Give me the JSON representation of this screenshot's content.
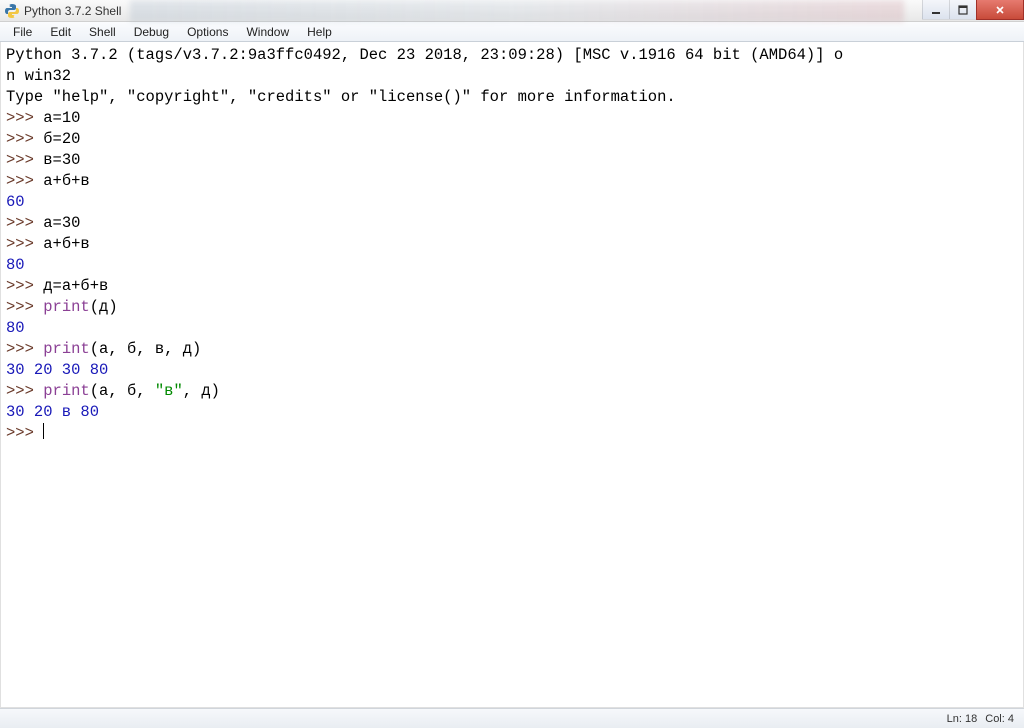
{
  "window": {
    "title": "Python 3.7.2 Shell"
  },
  "menus": [
    "File",
    "Edit",
    "Shell",
    "Debug",
    "Options",
    "Window",
    "Help"
  ],
  "shell": {
    "banner_l1": "Python 3.7.2 (tags/v3.7.2:9a3ffc0492, Dec 23 2018, 23:09:28) [MSC v.1916 64 bit (AMD64)] o",
    "banner_l2": "n win32",
    "banner_l3": "Type \"help\", \"copyright\", \"credits\" or \"license()\" for more information.",
    "prompt": ">>>",
    "lines": [
      {
        "in": "а=10"
      },
      {
        "in": "б=20"
      },
      {
        "in": "в=30"
      },
      {
        "in": "а+б+в"
      },
      {
        "out": "60"
      },
      {
        "in": "а=30"
      },
      {
        "in": "а+б+в"
      },
      {
        "out": "80"
      },
      {
        "in": "д=а+б+в"
      },
      {
        "print_args": "(д)"
      },
      {
        "out": "80"
      },
      {
        "print_args": "(а, б, в, д)"
      },
      {
        "out": "30 20 30 80"
      },
      {
        "print_pre": "(а, б, ",
        "print_str": "\"в\"",
        "print_post": ", д)"
      },
      {
        "out": "30 20 в 80"
      }
    ],
    "keyword_print": "print"
  },
  "status": {
    "line": "Ln: 18",
    "col": "Col: 4"
  }
}
